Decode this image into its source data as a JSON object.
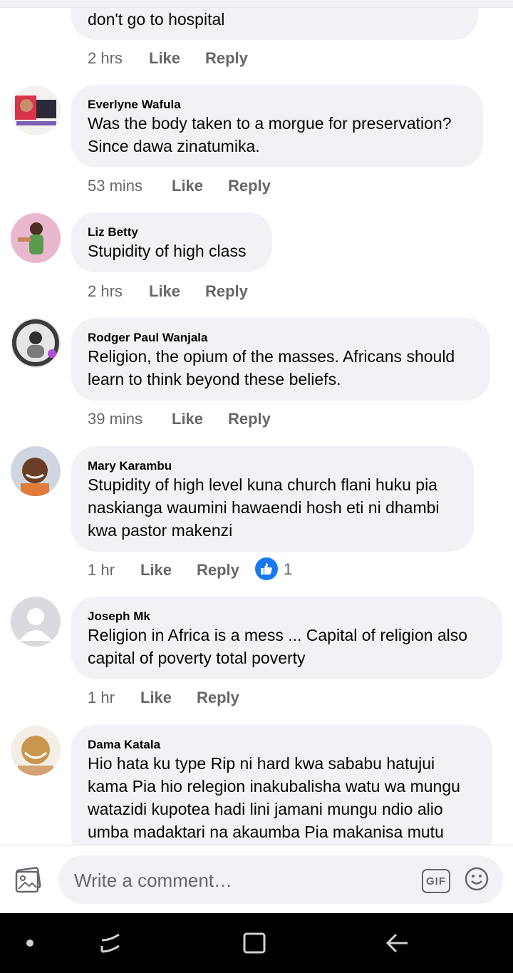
{
  "comments": [
    {
      "name": "",
      "lines": [
        "don't go to hospital"
      ],
      "time": "2 hrs",
      "like": "Like",
      "reply": "Reply"
    },
    {
      "name": "Everlyne Wafula",
      "lines": [
        "Was the body taken to a morgue for preservation?",
        "Since dawa zinatumika."
      ],
      "time": "53 mins",
      "like": "Like",
      "reply": "Reply"
    },
    {
      "name": "Liz Betty",
      "lines": [
        "Stupidity of high class"
      ],
      "time": "2 hrs",
      "like": "Like",
      "reply": "Reply"
    },
    {
      "name": "Rodger Paul Wanjala",
      "lines": [
        "Religion, the opium of the masses. Africans should",
        "learn to think beyond these beliefs."
      ],
      "time": "39 mins",
      "like": "Like",
      "reply": "Reply"
    },
    {
      "name": "Mary Karambu",
      "lines": [
        "Stupidity of high level  kuna church flani huku pia",
        "naskianga waumini hawaendi hosh eti ni dhambi",
        "kwa pastor makenzi"
      ],
      "time": "1 hr",
      "like": "Like",
      "reply": "Reply",
      "reaction_count": "1"
    },
    {
      "name": "Joseph Mk",
      "lines": [
        "Religion in Africa is a mess ... Capital of religion also",
        "capital of poverty total poverty"
      ],
      "time": "1 hr",
      "like": "Like",
      "reply": "Reply"
    },
    {
      "name": "Dama Katala",
      "lines": [
        "Hio hata ku type Rip ni hard kwa sababu hatujui",
        "kama Pia hio relegion inakubalisha watu wa mungu",
        "watazidi kupotea hadi lini jamani mungu ndio alio",
        "umba madaktari na akaumba Pia makanisa mutu"
      ]
    }
  ],
  "composer": {
    "placeholder": "Write a comment…",
    "gif_label": "GIF"
  },
  "icons": {
    "photo": "photo-icon",
    "gif": "gif-icon",
    "emoji": "emoji-icon",
    "like_reaction": "like-reaction-icon",
    "nav_dot": "nav-dot-icon",
    "nav_recents": "nav-recents-icon",
    "nav_home": "nav-home-icon",
    "nav_back": "nav-back-icon"
  },
  "colors": {
    "bubble": "#f0f2f5",
    "meta": "#65676b",
    "text": "#050505",
    "like_blue": "#1877f2"
  }
}
